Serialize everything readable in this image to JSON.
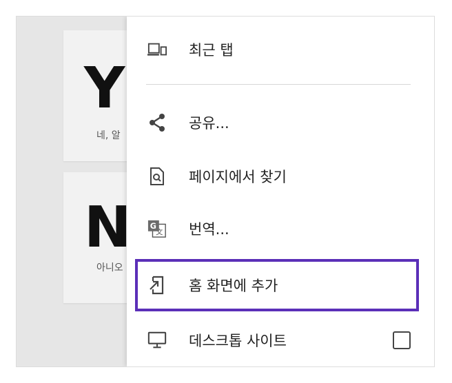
{
  "background_cards": [
    {
      "big": "Y",
      "small": "네, 알"
    },
    {
      "big": "N",
      "small": "아니오"
    }
  ],
  "menu": {
    "items": [
      {
        "label": "최근 탭",
        "icon": "devices-icon"
      },
      {
        "label": "공유...",
        "icon": "share-icon"
      },
      {
        "label": "페이지에서 찾기",
        "icon": "find-in-page-icon"
      },
      {
        "label": "번역...",
        "icon": "translate-icon"
      },
      {
        "label": "홈 화면에 추가",
        "icon": "add-to-home-icon"
      },
      {
        "label": "데스크톱 사이트",
        "icon": "desktop-icon"
      }
    ],
    "highlighted_index": 4,
    "desktop_site_checked": false
  },
  "colors": {
    "highlight_border": "#5b2fb8",
    "icon": "#444444",
    "text": "#222222"
  }
}
